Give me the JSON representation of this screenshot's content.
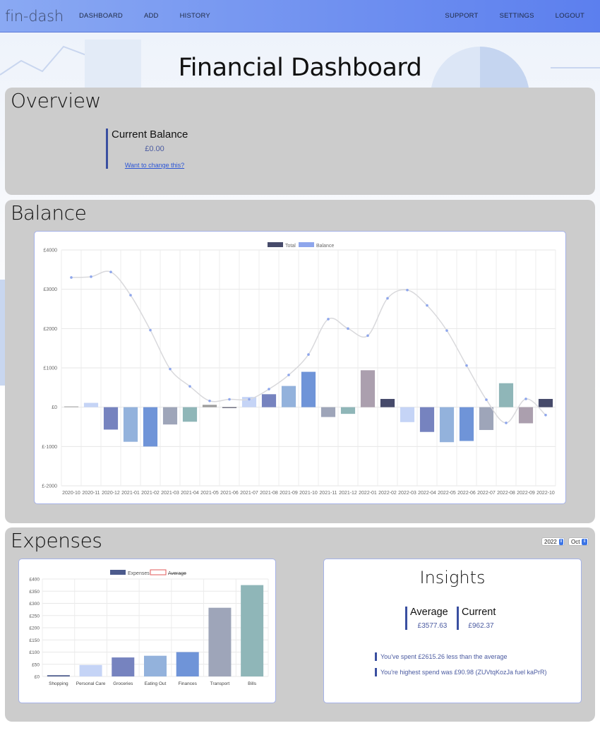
{
  "nav": {
    "brand": "fin-dash",
    "links": [
      "DASHBOARD",
      "ADD",
      "HISTORY"
    ],
    "right_links": [
      "SUPPORT",
      "SETTINGS",
      "LOGOUT"
    ]
  },
  "page_title": "Financial Dashboard",
  "overview": {
    "title": "Overview",
    "balance_label": "Current Balance",
    "balance_value": "£0.00",
    "change_link": "Want to change this?"
  },
  "balance": {
    "title": "Balance",
    "chart_data": {
      "type": "bar",
      "legend": [
        "Total",
        "Balance"
      ],
      "categories": [
        "2020-10",
        "2020-11",
        "2020-12",
        "2021-01",
        "2021-02",
        "2021-03",
        "2021-04",
        "2021-05",
        "2021-06",
        "2021-07",
        "2021-08",
        "2021-09",
        "2021-10",
        "2021-11",
        "2021-12",
        "2022-01",
        "2022-02",
        "2022-03",
        "2022-04",
        "2022-05",
        "2022-06",
        "2022-07",
        "2022-08",
        "2022-09",
        "2022-10"
      ],
      "series": [
        {
          "name": "Total",
          "type": "line",
          "values": [
            3300,
            3320,
            3440,
            2850,
            1960,
            970,
            530,
            160,
            200,
            200,
            460,
            820,
            1340,
            2240,
            2000,
            1820,
            2770,
            2980,
            2590,
            1950,
            1060,
            190,
            -400,
            210,
            -200
          ]
        },
        {
          "name": "Balance",
          "type": "bar",
          "values": [
            20,
            110,
            -570,
            -880,
            -1000,
            -440,
            -370,
            60,
            -20,
            260,
            330,
            540,
            900,
            -250,
            -170,
            940,
            210,
            -380,
            -630,
            -890,
            -860,
            -580,
            610,
            -410,
            210
          ]
        }
      ],
      "ylim": [
        -2000,
        4000
      ],
      "yticks": [
        "£4000",
        "£3000",
        "£2000",
        "£1000",
        "£0",
        "£-1000",
        "£-2000"
      ],
      "bar_colors": [
        "#a9a9a9",
        "#c5d4f6",
        "#7683bf",
        "#93b2dc",
        "#6f94d8",
        "#9ea5b9",
        "#8fb6b8",
        "#9d9d9d",
        "#4b4b60",
        "#c5d4f6",
        "#7683bf",
        "#93b2dc",
        "#6f94d8",
        "#9ea5b9",
        "#8fb6b8",
        "#ab9fae",
        "#464a6a",
        "#c5d4f6",
        "#7683bf",
        "#93b2dc",
        "#6f94d8",
        "#9ea5b9",
        "#8fb6b8",
        "#ab9fae",
        "#464a6a"
      ],
      "grid": true,
      "legend_position": "top"
    }
  },
  "expenses": {
    "title": "Expenses",
    "year_select": "2022",
    "month_select": "Oct",
    "chart_data": {
      "type": "bar",
      "legend": [
        "Expenses",
        "Average"
      ],
      "categories": [
        "Shopping",
        "Personal Care",
        "Groceries",
        "Eating Out",
        "Finances",
        "Transport",
        "Bills"
      ],
      "values": [
        5,
        47,
        78,
        85,
        100,
        282,
        375
      ],
      "ylim": [
        0,
        400
      ],
      "yticks": [
        "£400",
        "£350",
        "£300",
        "£250",
        "£200",
        "£150",
        "£100",
        "£50",
        "£0"
      ],
      "bar_colors": [
        "#4c5a8c",
        "#c5d4f6",
        "#7683bf",
        "#93b2dc",
        "#6f94d8",
        "#9ea5b9",
        "#8fb6b8"
      ],
      "grid": true,
      "legend_position": "top"
    },
    "insights": {
      "title": "Insights",
      "average_label": "Average",
      "average_value": "£3577.63",
      "current_label": "Current",
      "current_value": "£962.37",
      "message_1": "You've spent £2615.26 less than the average",
      "message_2": "You're highest spend was £90.98 (ZUVtqKozJa fuel kaPrR)"
    }
  }
}
